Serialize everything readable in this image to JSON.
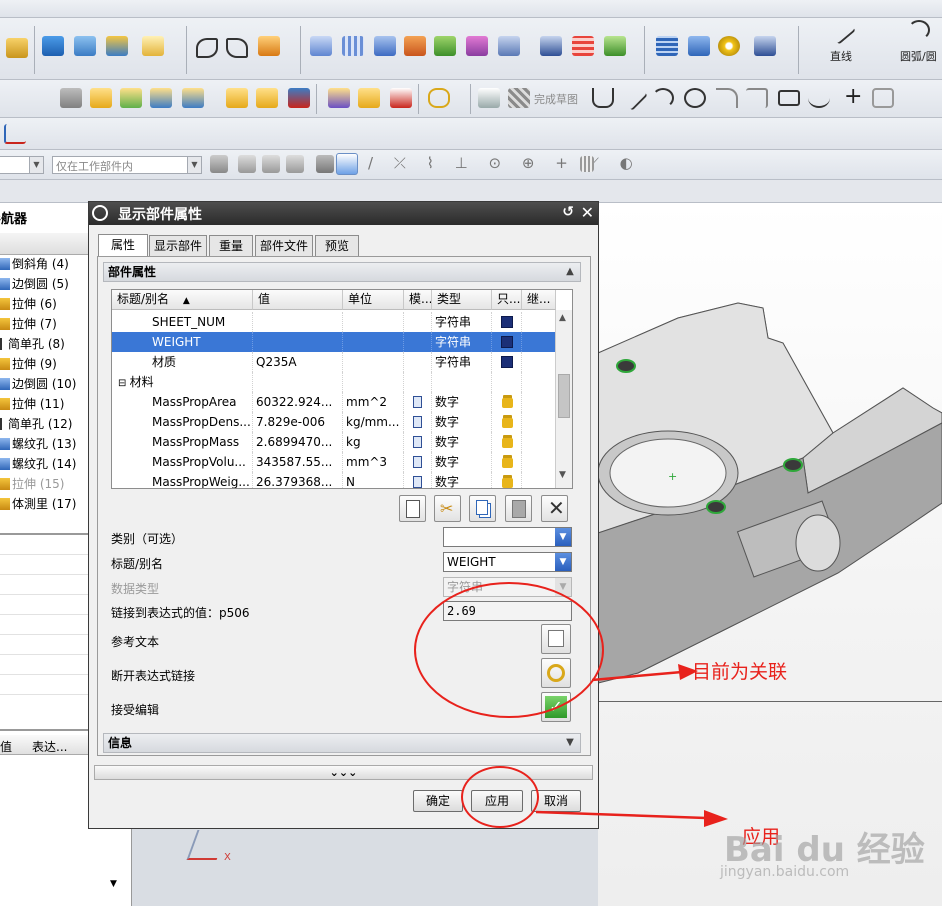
{
  "toolbar": {
    "sketch_finish": "完成草图",
    "line_label": "直线",
    "arc_label": "圆弧/圆",
    "filter_combo": "仅在工作部件内"
  },
  "navigator": {
    "title": "导航器",
    "items": [
      {
        "label": "倒斜角 (4)",
        "icon": "blue"
      },
      {
        "label": "边倒圆 (5)",
        "icon": "blue"
      },
      {
        "label": "拉伸 (6)",
        "icon": "yellow"
      },
      {
        "label": "拉伸 (7)",
        "icon": "yellow"
      },
      {
        "label": "简单孔 (8)",
        "icon": "line"
      },
      {
        "label": "拉伸 (9)",
        "icon": "yellow"
      },
      {
        "label": "边倒圆 (10)",
        "icon": "blue"
      },
      {
        "label": "拉伸 (11)",
        "icon": "yellow"
      },
      {
        "label": "简单孔 (12)",
        "icon": "line"
      },
      {
        "label": "螺纹孔 (13)",
        "icon": "blue"
      },
      {
        "label": "螺纹孔 (14)",
        "icon": "blue"
      },
      {
        "label": "拉伸 (15)",
        "icon": "yellow"
      },
      {
        "label": "体測里 (17)",
        "icon": "yellow"
      }
    ],
    "col_value": "值",
    "col_expr": "表达..."
  },
  "dialog": {
    "title": "显示部件属性",
    "tabs": [
      "属性",
      "显示部件",
      "重量",
      "部件文件",
      "预览"
    ],
    "group_title": "部件属性",
    "columns": [
      "标题/别名",
      "值",
      "单位",
      "模...",
      "类型",
      "只...",
      "继..."
    ],
    "rows": [
      {
        "name": "SHEET_NUM",
        "value": "",
        "unit": "",
        "type": "字符串",
        "indent": 2,
        "selected": false,
        "ro": "save"
      },
      {
        "name": "WEIGHT",
        "value": "",
        "unit": "",
        "type": "字符串",
        "indent": 2,
        "selected": true,
        "ro": "save"
      },
      {
        "name": "材质",
        "value": "Q235A",
        "unit": "",
        "type": "字符串",
        "indent": 2,
        "selected": false,
        "ro": "save"
      },
      {
        "name": "材料",
        "value": "",
        "unit": "",
        "type": "",
        "indent": 1,
        "selected": false,
        "ro": "",
        "group": true
      },
      {
        "name": "MassPropArea",
        "value": "60322.924...",
        "unit": "mm^2",
        "type": "数字",
        "indent": 2,
        "selected": false,
        "ro": "lock"
      },
      {
        "name": "MassPropDens...",
        "value": "7.829e-006",
        "unit": "kg/mm...",
        "type": "数字",
        "indent": 2,
        "selected": false,
        "ro": "lock"
      },
      {
        "name": "MassPropMass",
        "value": "2.6899470...",
        "unit": "kg",
        "type": "数字",
        "indent": 2,
        "selected": false,
        "ro": "lock"
      },
      {
        "name": "MassPropVolu...",
        "value": "343587.55...",
        "unit": "mm^3",
        "type": "数字",
        "indent": 2,
        "selected": false,
        "ro": "lock"
      },
      {
        "name": "MassPropWeig...",
        "value": "26.379368...",
        "unit": "N",
        "type": "数字",
        "indent": 2,
        "selected": false,
        "ro": "lock"
      }
    ],
    "category_label": "类别（可选）",
    "category_value": "",
    "title_label": "标题/别名",
    "title_value": "WEIGHT",
    "datatype_label": "数据类型",
    "datatype_value": "字符串",
    "link_label": "链接到表达式的值：p506",
    "link_value": "2.69",
    "ref_text_label": "参考文本",
    "break_link_label": "断开表达式链接",
    "accept_label": "接受编辑",
    "info_title": "信息",
    "more": "⌄⌄⌄",
    "ok": "确定",
    "apply": "应用",
    "cancel": "取消"
  },
  "annotations": {
    "linked_note": "目前为关联",
    "apply_note": "应用"
  },
  "watermark": {
    "brand": "Bai du 经验",
    "url": "jingyan.baidu.com"
  },
  "colors": {
    "selection": "#3a77d6",
    "annotation_red": "#e8221c",
    "title_bar": "#2b2b2b"
  }
}
